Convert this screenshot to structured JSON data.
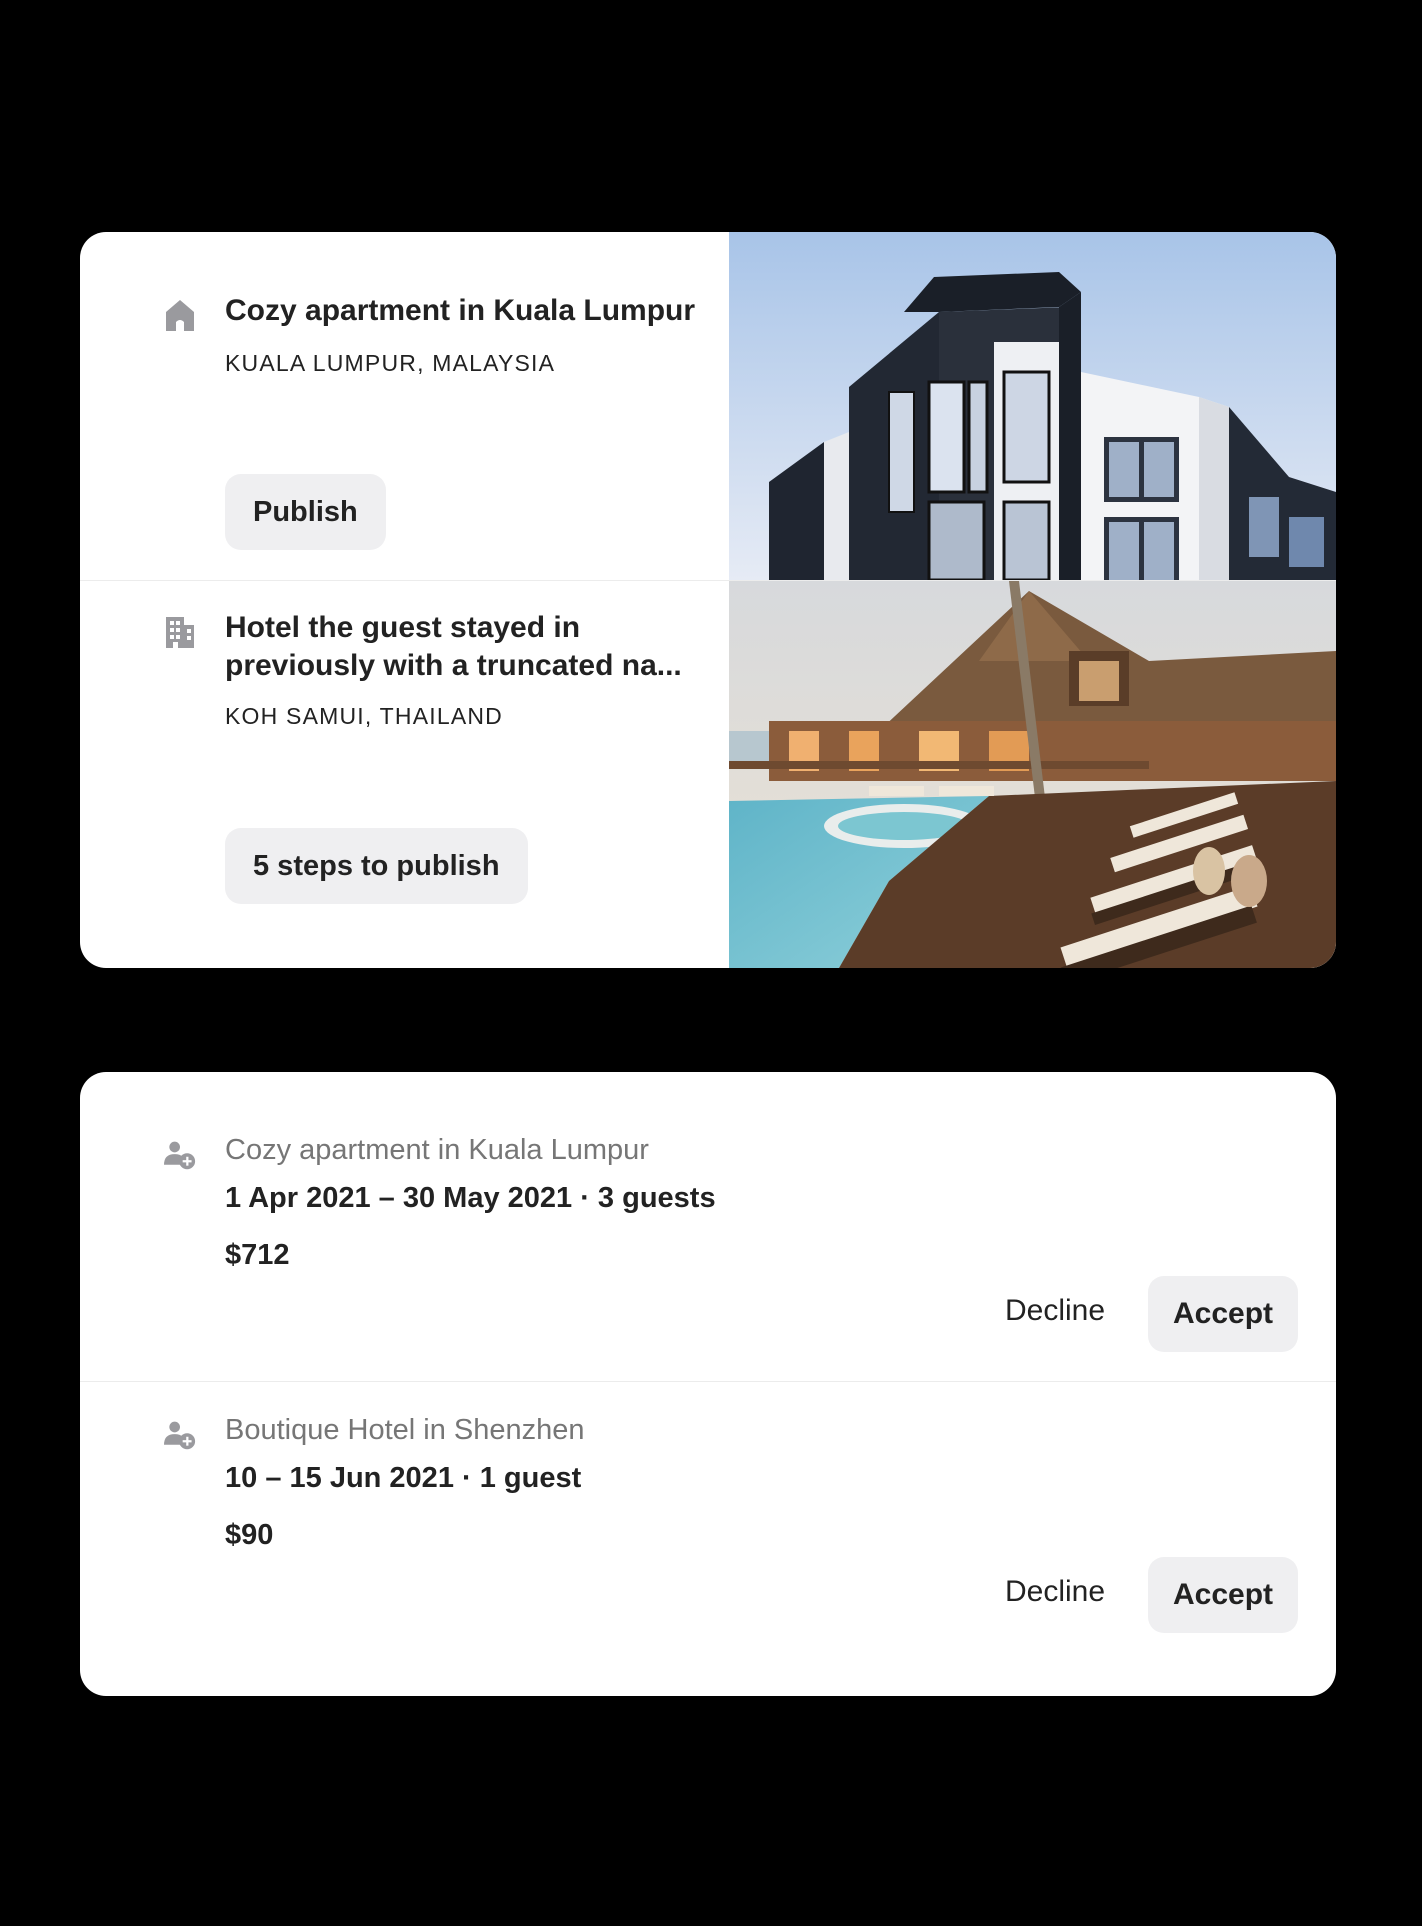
{
  "listings": [
    {
      "icon": "house-icon",
      "title": "Cozy apartment in Kuala Lumpur",
      "location": "KUALA LUMPUR, MALAYSIA",
      "action_label": "Publish",
      "photo": "modern-apartment-building-photo"
    },
    {
      "icon": "hotel-building-icon",
      "title": "Hotel the guest stayed in previously with a truncated na...",
      "location": "KOH SAMUI, THAILAND",
      "action_label": "5 steps to publish",
      "photo": "resort-pool-photo"
    }
  ],
  "requests": [
    {
      "icon": "person-add-icon",
      "listing_name": "Cozy apartment in Kuala Lumpur",
      "dates_guests": "1 Apr 2021 – 30 May 2021 · 3 guests",
      "price": "$712",
      "decline_label": "Decline",
      "accept_label": "Accept"
    },
    {
      "icon": "person-add-icon",
      "listing_name": "Boutique Hotel in Shenzhen",
      "dates_guests": "10 – 15 Jun 2021 · 1 guest",
      "price": "$90",
      "decline_label": "Decline",
      "accept_label": "Accept"
    }
  ],
  "colors": {
    "background": "#000000",
    "card": "#ffffff",
    "button_fill": "#efeff1",
    "primary_text": "#222222",
    "secondary_text": "#767676",
    "icon": "#9a9a9e"
  }
}
